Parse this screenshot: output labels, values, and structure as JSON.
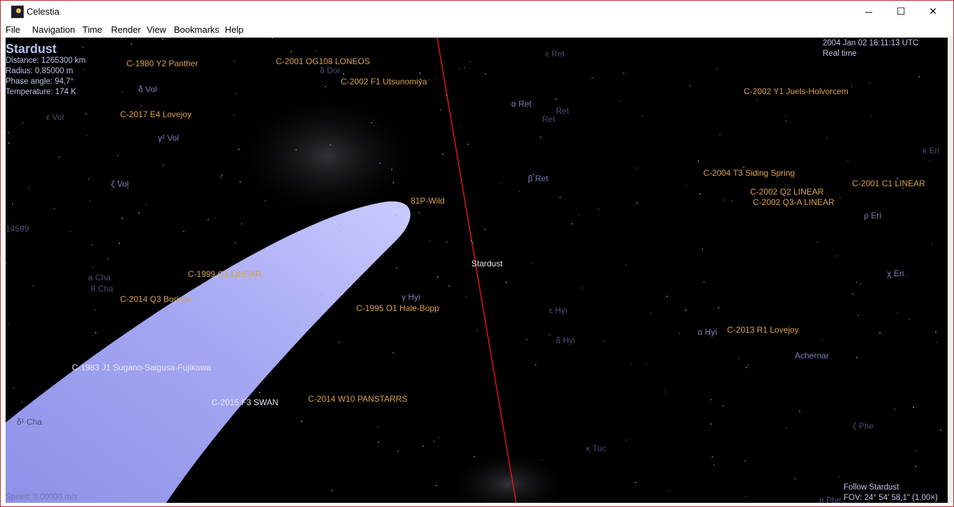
{
  "window": {
    "title": "Celestia",
    "minimize": "─",
    "maximize": "☐",
    "close": "✕"
  },
  "menu": [
    "File",
    "Navigation",
    "Time",
    "Render",
    "View",
    "Bookmarks",
    "Help"
  ],
  "overlay": {
    "target": "Stardust",
    "distance": "Distance: 1265300 km",
    "radius": "Radius: 0,85000 m",
    "phase": "Phase angle: 94,7°",
    "temperature": "Temperature: 174 K",
    "datetime": "2004 Jan 02 16:11:13 UTC",
    "timemode": "Real time",
    "speed": "Speed: 0,00000 m/s",
    "follow": "Follow Stardust",
    "fov": "FOV: 24° 54' 58,1\" (1,00×)"
  },
  "comets": {
    "c1980": "C-1980 Y2 Panther",
    "c2001og": "C-2001 OG108 LONEOS",
    "c2002f1": "C-2002 F1 Utsunomiya",
    "c2017": "C-2017 E4 Lovejoy",
    "c2002y1": "C-2002 Y1 Juels-Holvorcem",
    "c2004t3": "C-2004 T3 Siding Spring",
    "c2002q2": "C-2002 Q2 LINEAR",
    "c2002q3": "C-2002 Q3-A LINEAR",
    "c2001c1": "C-2001 C1 LINEAR",
    "wild": "81P-Wild",
    "c1999": "C-1999 G1 LINEAR",
    "c2014q3": "C-2014 Q3 Borisov",
    "c1995": "C-1995 O1 Hale-Bopp",
    "c2013": "C-2013 R1 Lovejoy",
    "c1983": "C-1983 J1 Sugano-Saigusa-Fujikawa",
    "c2015": "C-2015 F3 SWAN",
    "c2014w10": "C-2014 W10 PANSTARRS"
  },
  "stars": {
    "dvol": "δ Vol",
    "evol": "ε Vol",
    "g2vol": "γ² Vol",
    "zvol": "ζ Vol",
    "aret": "α Ret",
    "bret": "β Ret",
    "eret": "ε Ret",
    "ret2": "Ret",
    "ret3": "Ret",
    "dor": "δ Dor",
    "keri": "κ Eri",
    "rhoeri": "ρ Eri",
    "chieri": "χ Eri",
    "acha": "α Cha",
    "bcha": "θ Cha",
    "ghyi": "γ Hyi",
    "ehyi": "ε Hyi",
    "dhyi": "δ Hyi",
    "ahyi": "α Hyi",
    "achernar": "Achernar",
    "zphe": "ζ Phe",
    "ktuc": "κ Tuc",
    "dcha": "δ¹ Cha",
    "hd": "14599",
    "phe": "η Phe"
  },
  "spacecraft": "Stardust"
}
